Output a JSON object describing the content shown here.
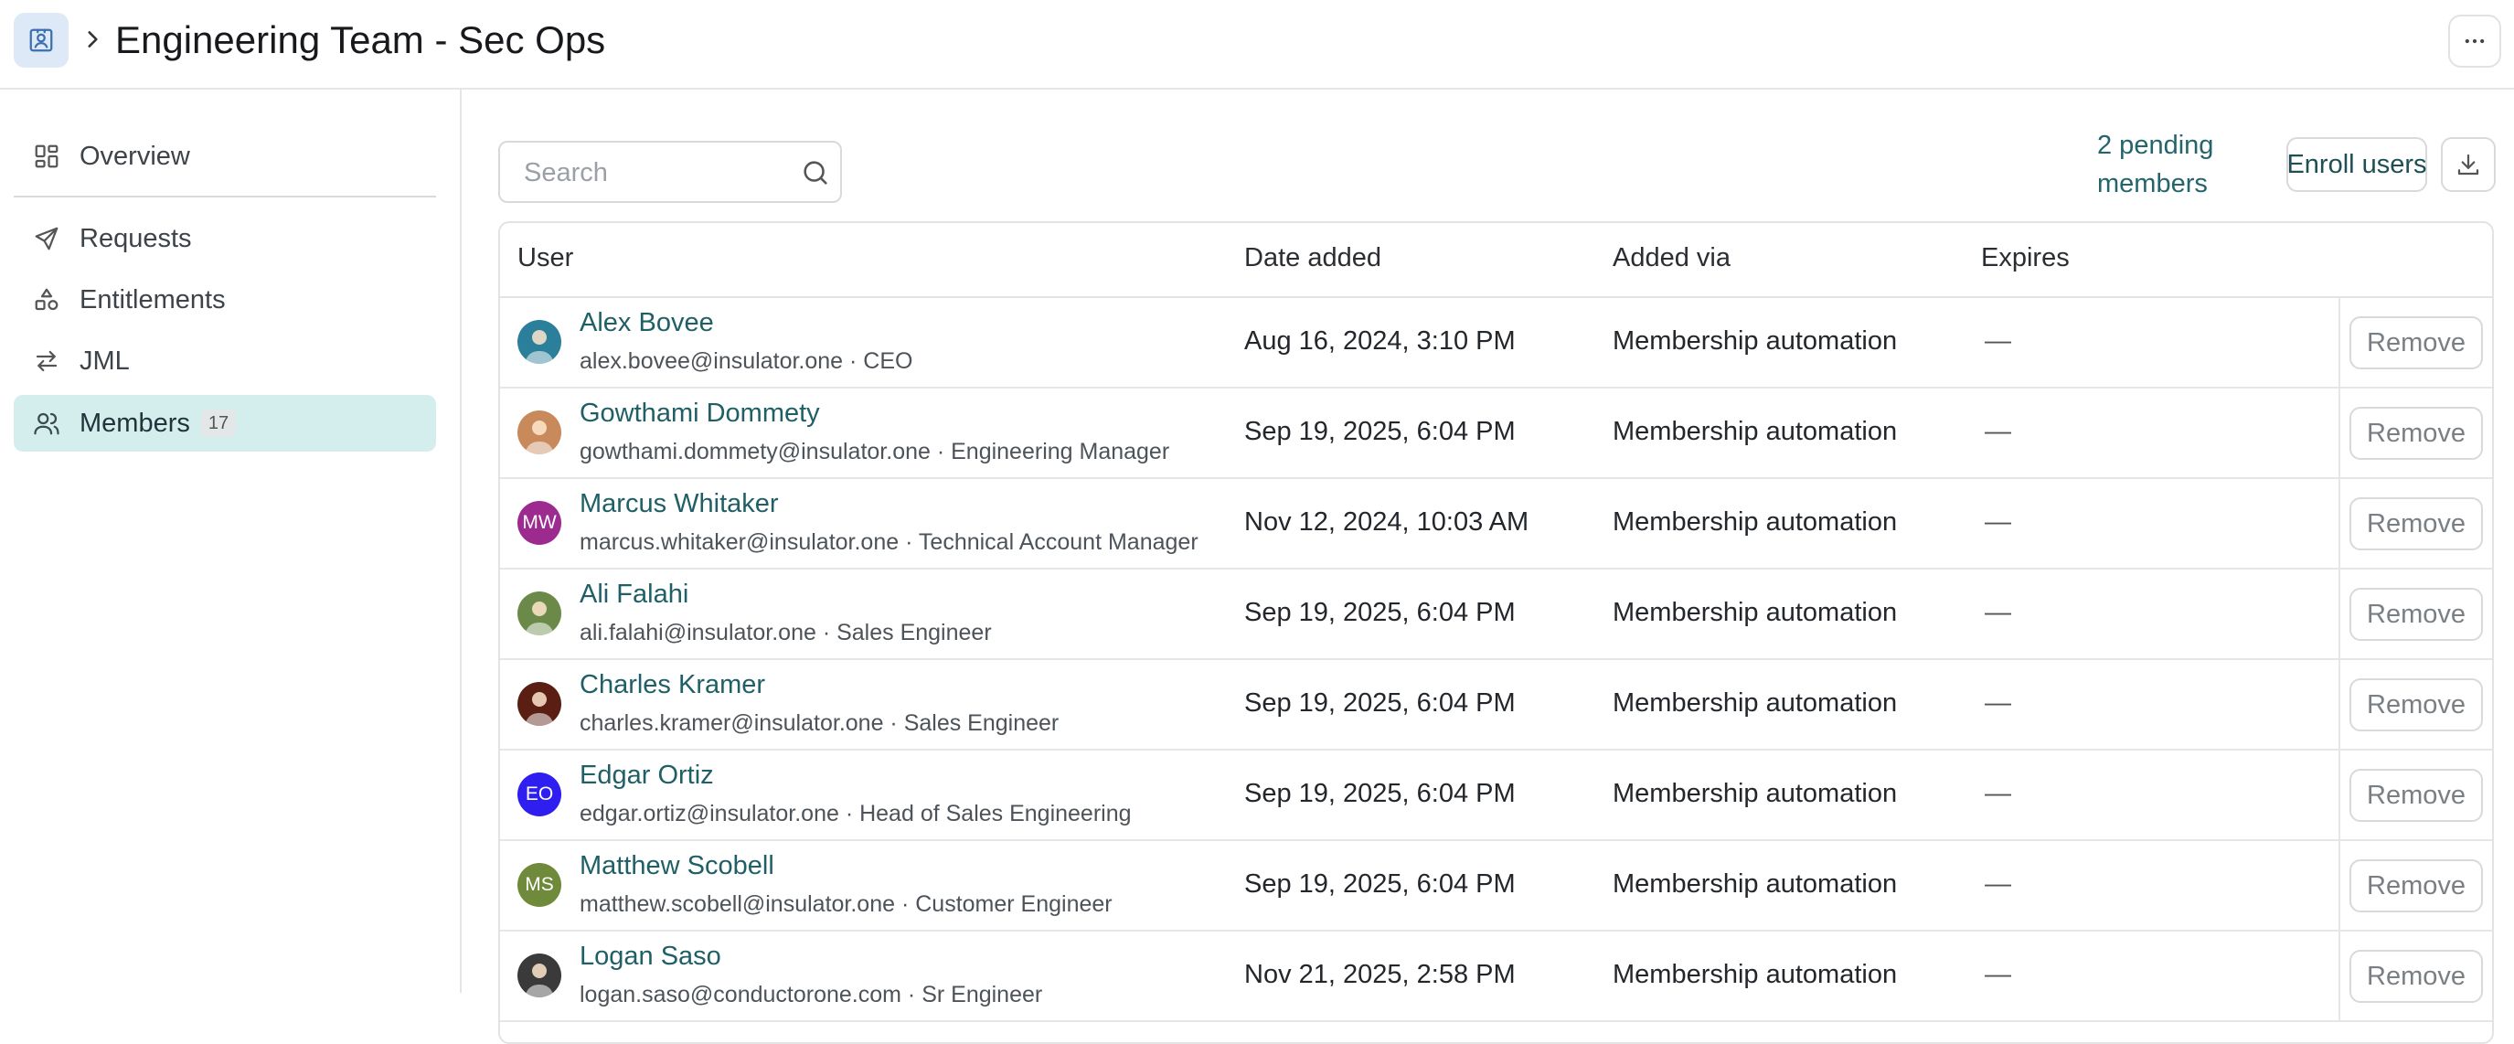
{
  "header": {
    "title": "Engineering Team - Sec Ops",
    "group_icon": "contact-badge-icon",
    "chevron_icon": "chevron-right-icon",
    "more_icon": "more-horizontal-icon"
  },
  "sidebar": {
    "items": [
      {
        "label": "Overview",
        "icon": "dashboard-icon"
      },
      {
        "label": "Requests",
        "icon": "send-icon"
      },
      {
        "label": "Entitlements",
        "icon": "shapes-icon"
      },
      {
        "label": "JML",
        "icon": "arrows-swap-icon"
      },
      {
        "label": "Members",
        "icon": "users-icon",
        "badge": "17",
        "active": true
      }
    ]
  },
  "toolbar": {
    "search_placeholder": "Search",
    "pending_label": "2 pending members",
    "enroll_label": "Enroll users",
    "download_icon": "download-icon"
  },
  "table": {
    "columns": [
      "User",
      "Date added",
      "Added via",
      "Expires"
    ],
    "rows": [
      {
        "name": "Alex Bovee",
        "sub": "alex.bovee@insulator.one · CEO",
        "date": "Aug 16, 2024, 3:10 PM",
        "via": "Membership automation",
        "expires": "—",
        "action": "Remove",
        "avatar": {
          "type": "photo",
          "color": "#2b7f9a"
        }
      },
      {
        "name": "Gowthami Dommety",
        "sub": "gowthami.dommety@insulator.one · Engineering Manager",
        "date": "Sep 19, 2025, 6:04 PM",
        "via": "Membership automation",
        "expires": "—",
        "action": "Remove",
        "avatar": {
          "type": "photo",
          "color": "#c98a5b"
        }
      },
      {
        "name": "Marcus Whitaker",
        "sub": "marcus.whitaker@insulator.one · Technical Account Manager",
        "date": "Nov 12, 2024, 10:03 AM",
        "via": "Membership automation",
        "expires": "—",
        "action": "Remove",
        "avatar": {
          "type": "initials",
          "initials": "MW",
          "color": "#9c2a8f"
        }
      },
      {
        "name": "Ali Falahi",
        "sub": "ali.falahi@insulator.one · Sales Engineer",
        "date": "Sep 19, 2025, 6:04 PM",
        "via": "Membership automation",
        "expires": "—",
        "action": "Remove",
        "avatar": {
          "type": "photo",
          "color": "#6b8a4a"
        }
      },
      {
        "name": "Charles Kramer",
        "sub": "charles.kramer@insulator.one · Sales Engineer",
        "date": "Sep 19, 2025, 6:04 PM",
        "via": "Membership automation",
        "expires": "—",
        "action": "Remove",
        "avatar": {
          "type": "photo",
          "color": "#5a1e12"
        }
      },
      {
        "name": "Edgar Ortiz",
        "sub": "edgar.ortiz@insulator.one · Head of Sales Engineering",
        "date": "Sep 19, 2025, 6:04 PM",
        "via": "Membership automation",
        "expires": "—",
        "action": "Remove",
        "avatar": {
          "type": "initials",
          "initials": "EO",
          "color": "#2f1ef0"
        }
      },
      {
        "name": "Matthew Scobell",
        "sub": "matthew.scobell@insulator.one · Customer Engineer",
        "date": "Sep 19, 2025, 6:04 PM",
        "via": "Membership automation",
        "expires": "—",
        "action": "Remove",
        "avatar": {
          "type": "initials",
          "initials": "MS",
          "color": "#6f8a3a"
        }
      },
      {
        "name": "Logan Saso",
        "sub": "logan.saso@conductorone.com · Sr Engineer",
        "date": "Nov 21, 2025, 2:58 PM",
        "via": "Membership automation",
        "expires": "—",
        "action": "Remove",
        "avatar": {
          "type": "photo",
          "color": "#3a3a3a"
        }
      }
    ]
  }
}
